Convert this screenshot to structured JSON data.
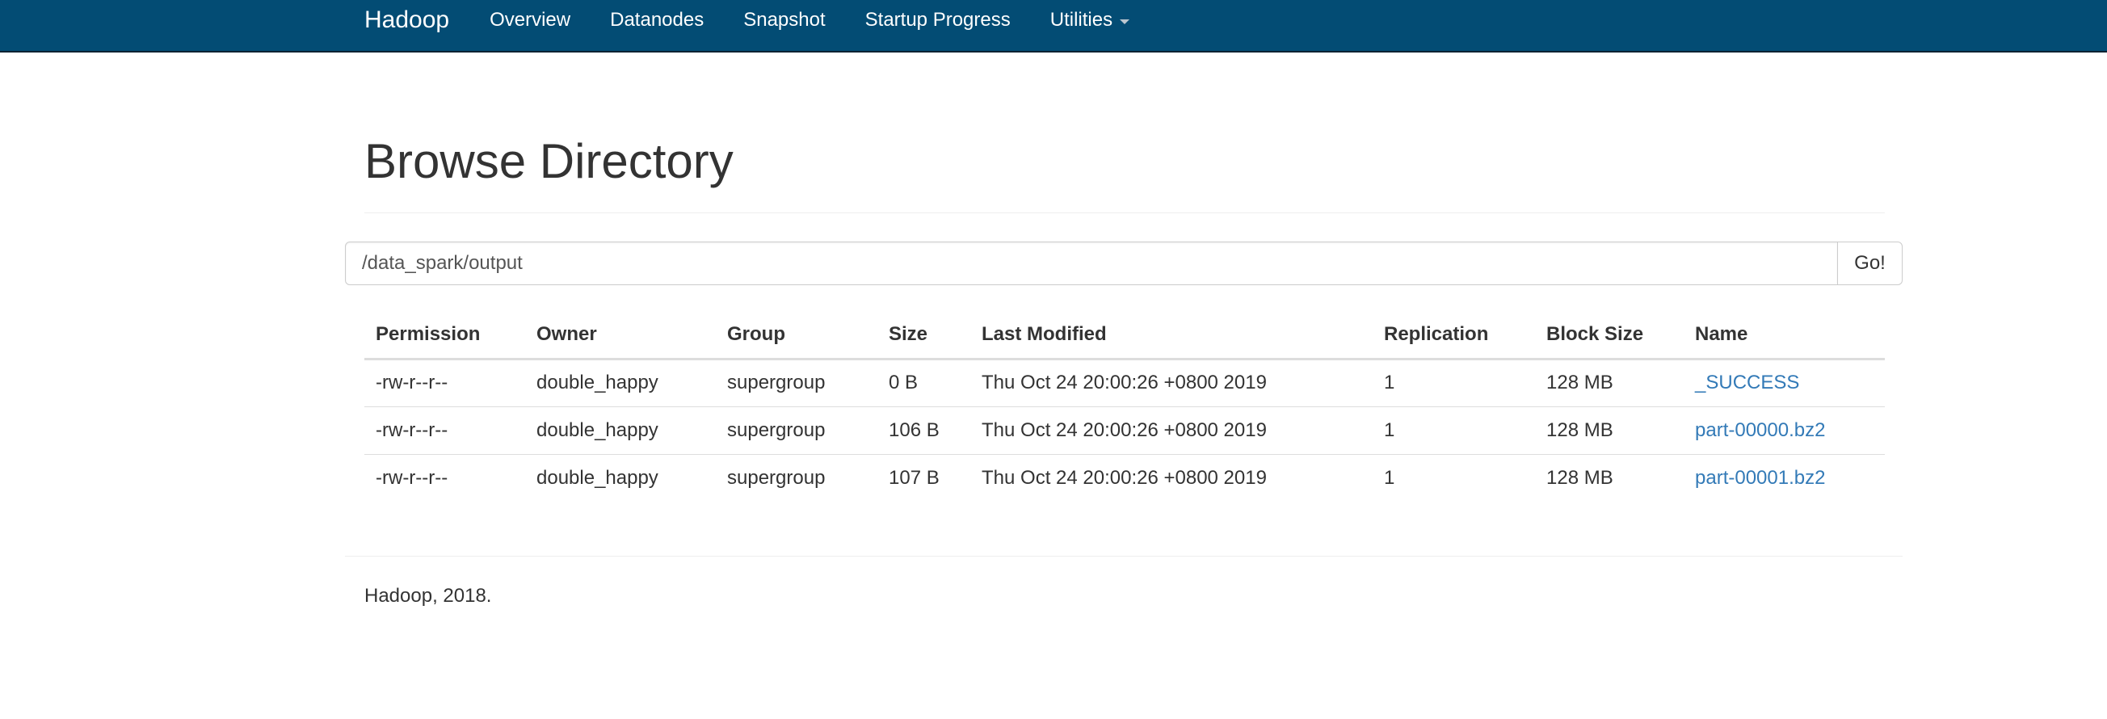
{
  "navbar": {
    "brand": "Hadoop",
    "items": [
      {
        "label": "Overview"
      },
      {
        "label": "Datanodes"
      },
      {
        "label": "Snapshot"
      },
      {
        "label": "Startup Progress"
      },
      {
        "label": "Utilities"
      }
    ]
  },
  "page": {
    "title": "Browse Directory"
  },
  "path_bar": {
    "value": "/data_spark/output",
    "go_label": "Go!"
  },
  "table": {
    "columns": [
      "Permission",
      "Owner",
      "Group",
      "Size",
      "Last Modified",
      "Replication",
      "Block Size",
      "Name"
    ],
    "rows": [
      {
        "permission": "-rw-r--r--",
        "owner": "double_happy",
        "group": "supergroup",
        "size": "0 B",
        "last_modified": "Thu Oct 24 20:00:26 +0800 2019",
        "replication": "1",
        "block_size": "128 MB",
        "name": "_SUCCESS"
      },
      {
        "permission": "-rw-r--r--",
        "owner": "double_happy",
        "group": "supergroup",
        "size": "106 B",
        "last_modified": "Thu Oct 24 20:00:26 +0800 2019",
        "replication": "1",
        "block_size": "128 MB",
        "name": "part-00000.bz2"
      },
      {
        "permission": "-rw-r--r--",
        "owner": "double_happy",
        "group": "supergroup",
        "size": "107 B",
        "last_modified": "Thu Oct 24 20:00:26 +0800 2019",
        "replication": "1",
        "block_size": "128 MB",
        "name": "part-00001.bz2"
      }
    ]
  },
  "footer": {
    "text": "Hadoop, 2018."
  },
  "colors": {
    "navbar_bg": "#034c74",
    "link": "#337ab7",
    "text": "#333333"
  },
  "icons": {
    "utilities_dropdown": "caret-down-icon"
  }
}
